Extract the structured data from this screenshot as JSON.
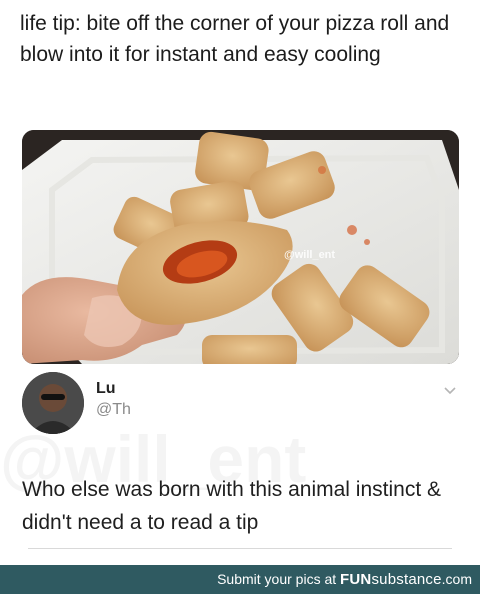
{
  "meme": {
    "caption": "life tip: bite off the corner of your pizza roll and blow into it for instant and easy cooling",
    "photo_watermark": "@will_ent"
  },
  "tweet": {
    "name": "Lu",
    "handle": "@Th",
    "body": "Who else was born with this animal instinct & didn't need a to read a tip",
    "faint_watermark": "@will_ent",
    "menu_icon": "chevron-down-icon"
  },
  "footer": {
    "prefix": "Submit your pics at ",
    "brand_bold": "FUN",
    "brand_rest": "substance",
    "suffix": ".com",
    "background": "#2f5a61"
  }
}
